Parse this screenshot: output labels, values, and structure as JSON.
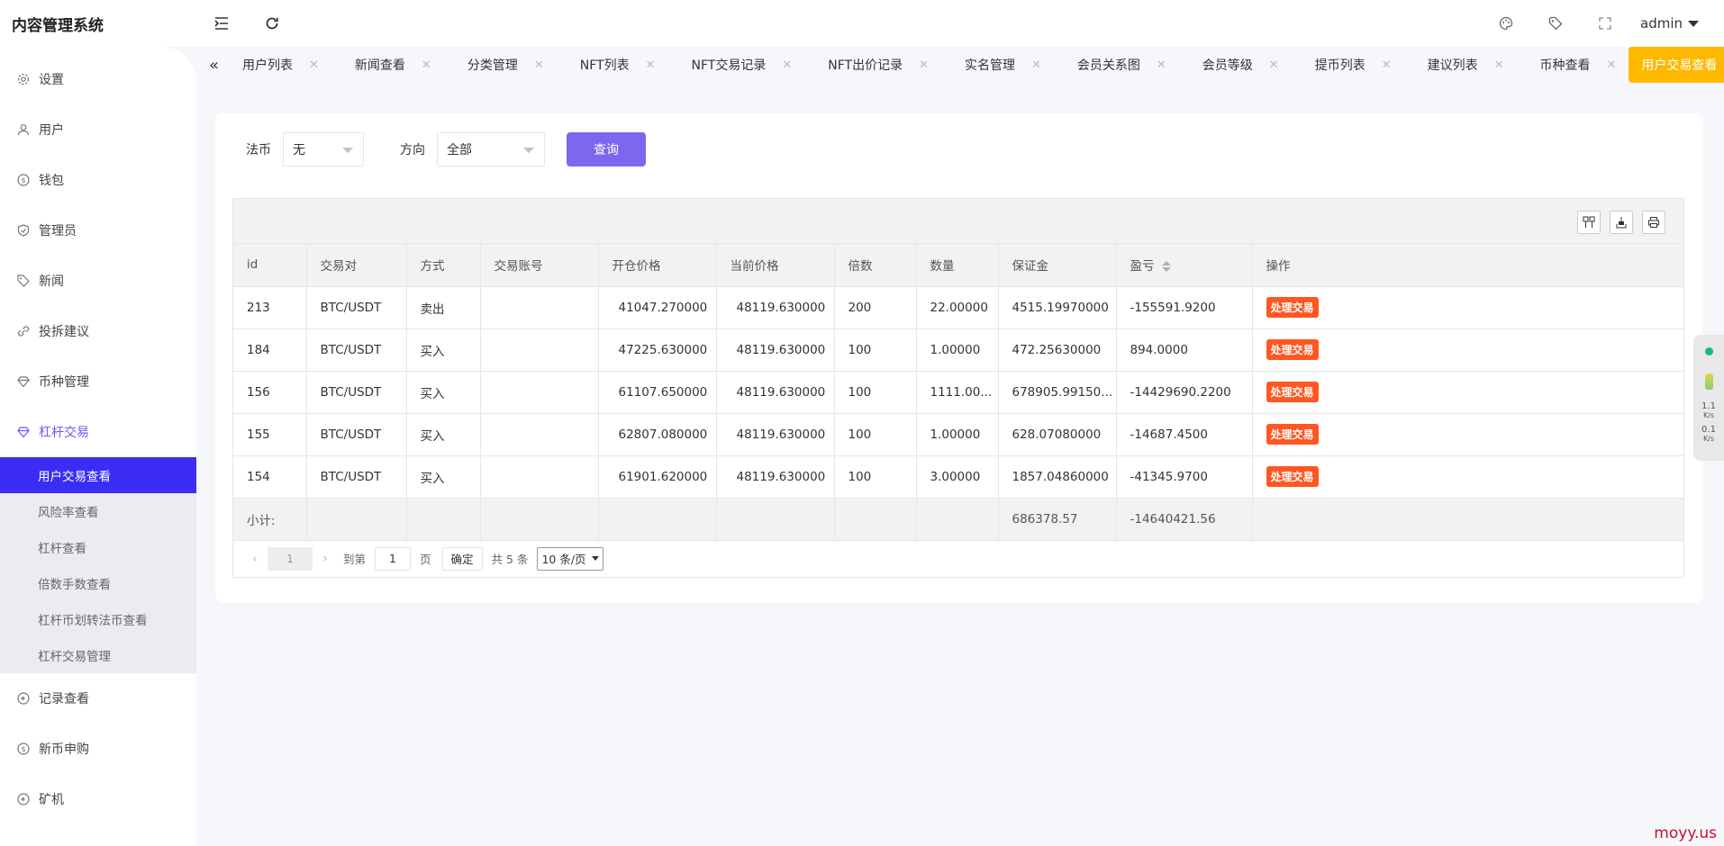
{
  "app": {
    "title": "内容管理系统"
  },
  "header": {
    "user": "admin"
  },
  "sidebar": {
    "items": [
      {
        "label": "设置",
        "icon": "gear-icon"
      },
      {
        "label": "用户",
        "icon": "user-icon"
      },
      {
        "label": "钱包",
        "icon": "dollar-icon"
      },
      {
        "label": "管理员",
        "icon": "shield-icon"
      },
      {
        "label": "新闻",
        "icon": "tag-icon"
      },
      {
        "label": "投拆建议",
        "icon": "link-icon"
      },
      {
        "label": "币种管理",
        "icon": "diamond-icon"
      },
      {
        "label": "杠杆交易",
        "icon": "diamond-icon"
      }
    ],
    "sub_items": [
      "用户交易查看",
      "风险率查看",
      "杠杆查看",
      "倍数手数查看",
      "杠杆币划转法币查看",
      "杠杆交易管理"
    ],
    "bottom_items": [
      {
        "label": "记录查看",
        "icon": "record-icon"
      },
      {
        "label": "新币申购",
        "icon": "dollar-icon"
      },
      {
        "label": "矿机",
        "icon": "record-icon"
      }
    ]
  },
  "tabs": [
    "用户列表",
    "新闻查看",
    "分类管理",
    "NFT列表",
    "NFT交易记录",
    "NFT出价记录",
    "实名管理",
    "会员关系图",
    "会员等级",
    "提币列表",
    "建议列表",
    "币种查看",
    "用户交易查看"
  ],
  "filter": {
    "fiat_label": "法币",
    "fiat_value": "无",
    "direction_label": "方向",
    "direction_value": "全部",
    "query_label": "查询"
  },
  "table": {
    "columns": [
      "id",
      "交易对",
      "方式",
      "交易账号",
      "开仓价格",
      "当前价格",
      "倍数",
      "数量",
      "保证金",
      "盈亏",
      "操作"
    ],
    "rows": [
      [
        "213",
        "BTC/USDT",
        "卖出",
        "",
        "41047.270000",
        "48119.630000",
        "200",
        "22.00000",
        "4515.19970000",
        "-155591.9200",
        "处理交易"
      ],
      [
        "184",
        "BTC/USDT",
        "买入",
        "",
        "47225.630000",
        "48119.630000",
        "100",
        "1.00000",
        "472.25630000",
        "894.0000",
        "处理交易"
      ],
      [
        "156",
        "BTC/USDT",
        "买入",
        "",
        "61107.650000",
        "48119.630000",
        "100",
        "1111.00...",
        "678905.99150...",
        "-14429690.2200",
        "处理交易"
      ],
      [
        "155",
        "BTC/USDT",
        "买入",
        "",
        "62807.080000",
        "48119.630000",
        "100",
        "1.00000",
        "628.07080000",
        "-14687.4500",
        "处理交易"
      ],
      [
        "154",
        "BTC/USDT",
        "买入",
        "",
        "61901.620000",
        "48119.630000",
        "100",
        "3.00000",
        "1857.04860000",
        "-41345.9700",
        "处理交易"
      ]
    ],
    "subtotal": {
      "label": "小计:",
      "margin": "686378.57",
      "pnl": "-14640421.56"
    }
  },
  "pager": {
    "current": "1",
    "goto_label": "到第",
    "goto_value": "1",
    "page_unit": "页",
    "confirm": "确定",
    "total": "共 5 条",
    "page_size": "10 条/页"
  },
  "net_widget": {
    "up": "1.1",
    "down": "0.1",
    "unit": "K/s"
  },
  "watermark": "moyy.us"
}
